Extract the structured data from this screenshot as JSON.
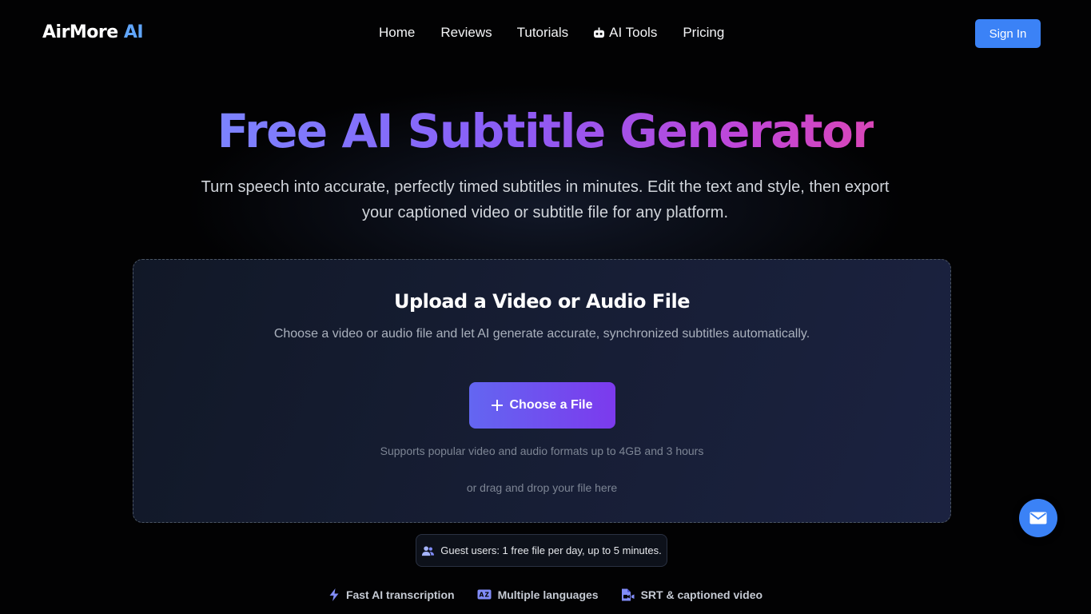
{
  "header": {
    "logo_main": "AirMore",
    "logo_accent": "AI",
    "nav": [
      {
        "label": "Home"
      },
      {
        "label": "Reviews"
      },
      {
        "label": "Tutorials"
      },
      {
        "label": "AI Tools",
        "icon": "robot-icon"
      },
      {
        "label": "Pricing"
      }
    ],
    "sign_in": "Sign In"
  },
  "hero": {
    "title": "Free AI Subtitle Generator",
    "subtitle": "Turn speech into accurate, perfectly timed subtitles in minutes. Edit the text and style, then export your captioned video or subtitle file for any platform."
  },
  "upload": {
    "title": "Upload a Video or Audio File",
    "description": "Choose a video or audio file and let AI generate accurate, synchronized subtitles automatically.",
    "button_label": "Choose a File",
    "formats_note": "Supports popular video and audio formats up to 4GB and 3 hours",
    "drag_note": "or drag and drop your file here"
  },
  "guest_note": "Guest users: 1 free file per day, up to 5 minutes.",
  "features": [
    {
      "label": "Fast AI transcription",
      "icon": "lightning-icon"
    },
    {
      "label": "Multiple languages",
      "icon": "language-icon"
    },
    {
      "label": "SRT & captioned video",
      "icon": "file-video-icon"
    }
  ],
  "colors": {
    "accent": "#3b82f6",
    "button_gradient_start": "#6366f1",
    "button_gradient_end": "#7c3aed",
    "background": "#020203"
  }
}
